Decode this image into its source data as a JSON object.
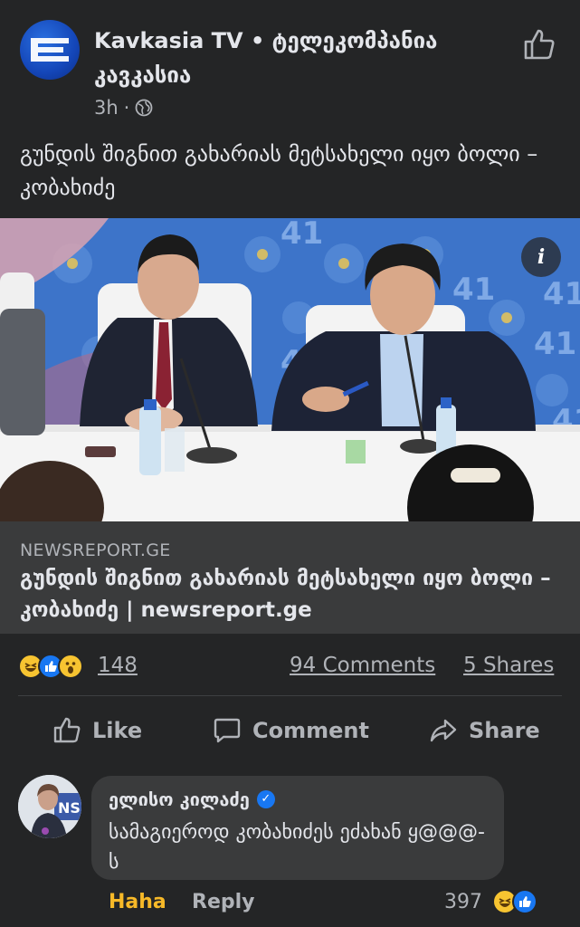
{
  "post": {
    "page_name": "Kavkasia TV • ტელეკომპანია კავკასია",
    "time": "3h",
    "dot": "·",
    "privacy_icon": "globe-icon",
    "text": "გუნდის შიგნით გახარიას მეტსახელი იყო ბოლი – კობახიძე",
    "image_info_label": "i"
  },
  "link": {
    "domain": "NEWSREPORT.GE",
    "title": "გუნდის შიგნით გახარიას მეტსახელი იყო ბოლი – კობახიძე | newsreport.ge"
  },
  "stats": {
    "reaction_icons": [
      "haha-icon",
      "like-icon",
      "wow-icon"
    ],
    "reaction_count": "148",
    "comments": "94 Comments",
    "shares": "5 Shares"
  },
  "actions": {
    "like": "Like",
    "comment": "Comment",
    "share": "Share"
  },
  "comment": {
    "author": "ელისო კილაძე",
    "verified": "✓",
    "text": "სამაგიეროდ კობახიძეს ეძახან ყ@@@-ს",
    "haha_label": "Haha",
    "reply_label": "Reply",
    "reaction_count": "397"
  },
  "colors": {
    "background": "#242526",
    "link_box": "#3a3b3c",
    "accent_blue": "#1877f2",
    "haha_yellow": "#f7b928"
  }
}
